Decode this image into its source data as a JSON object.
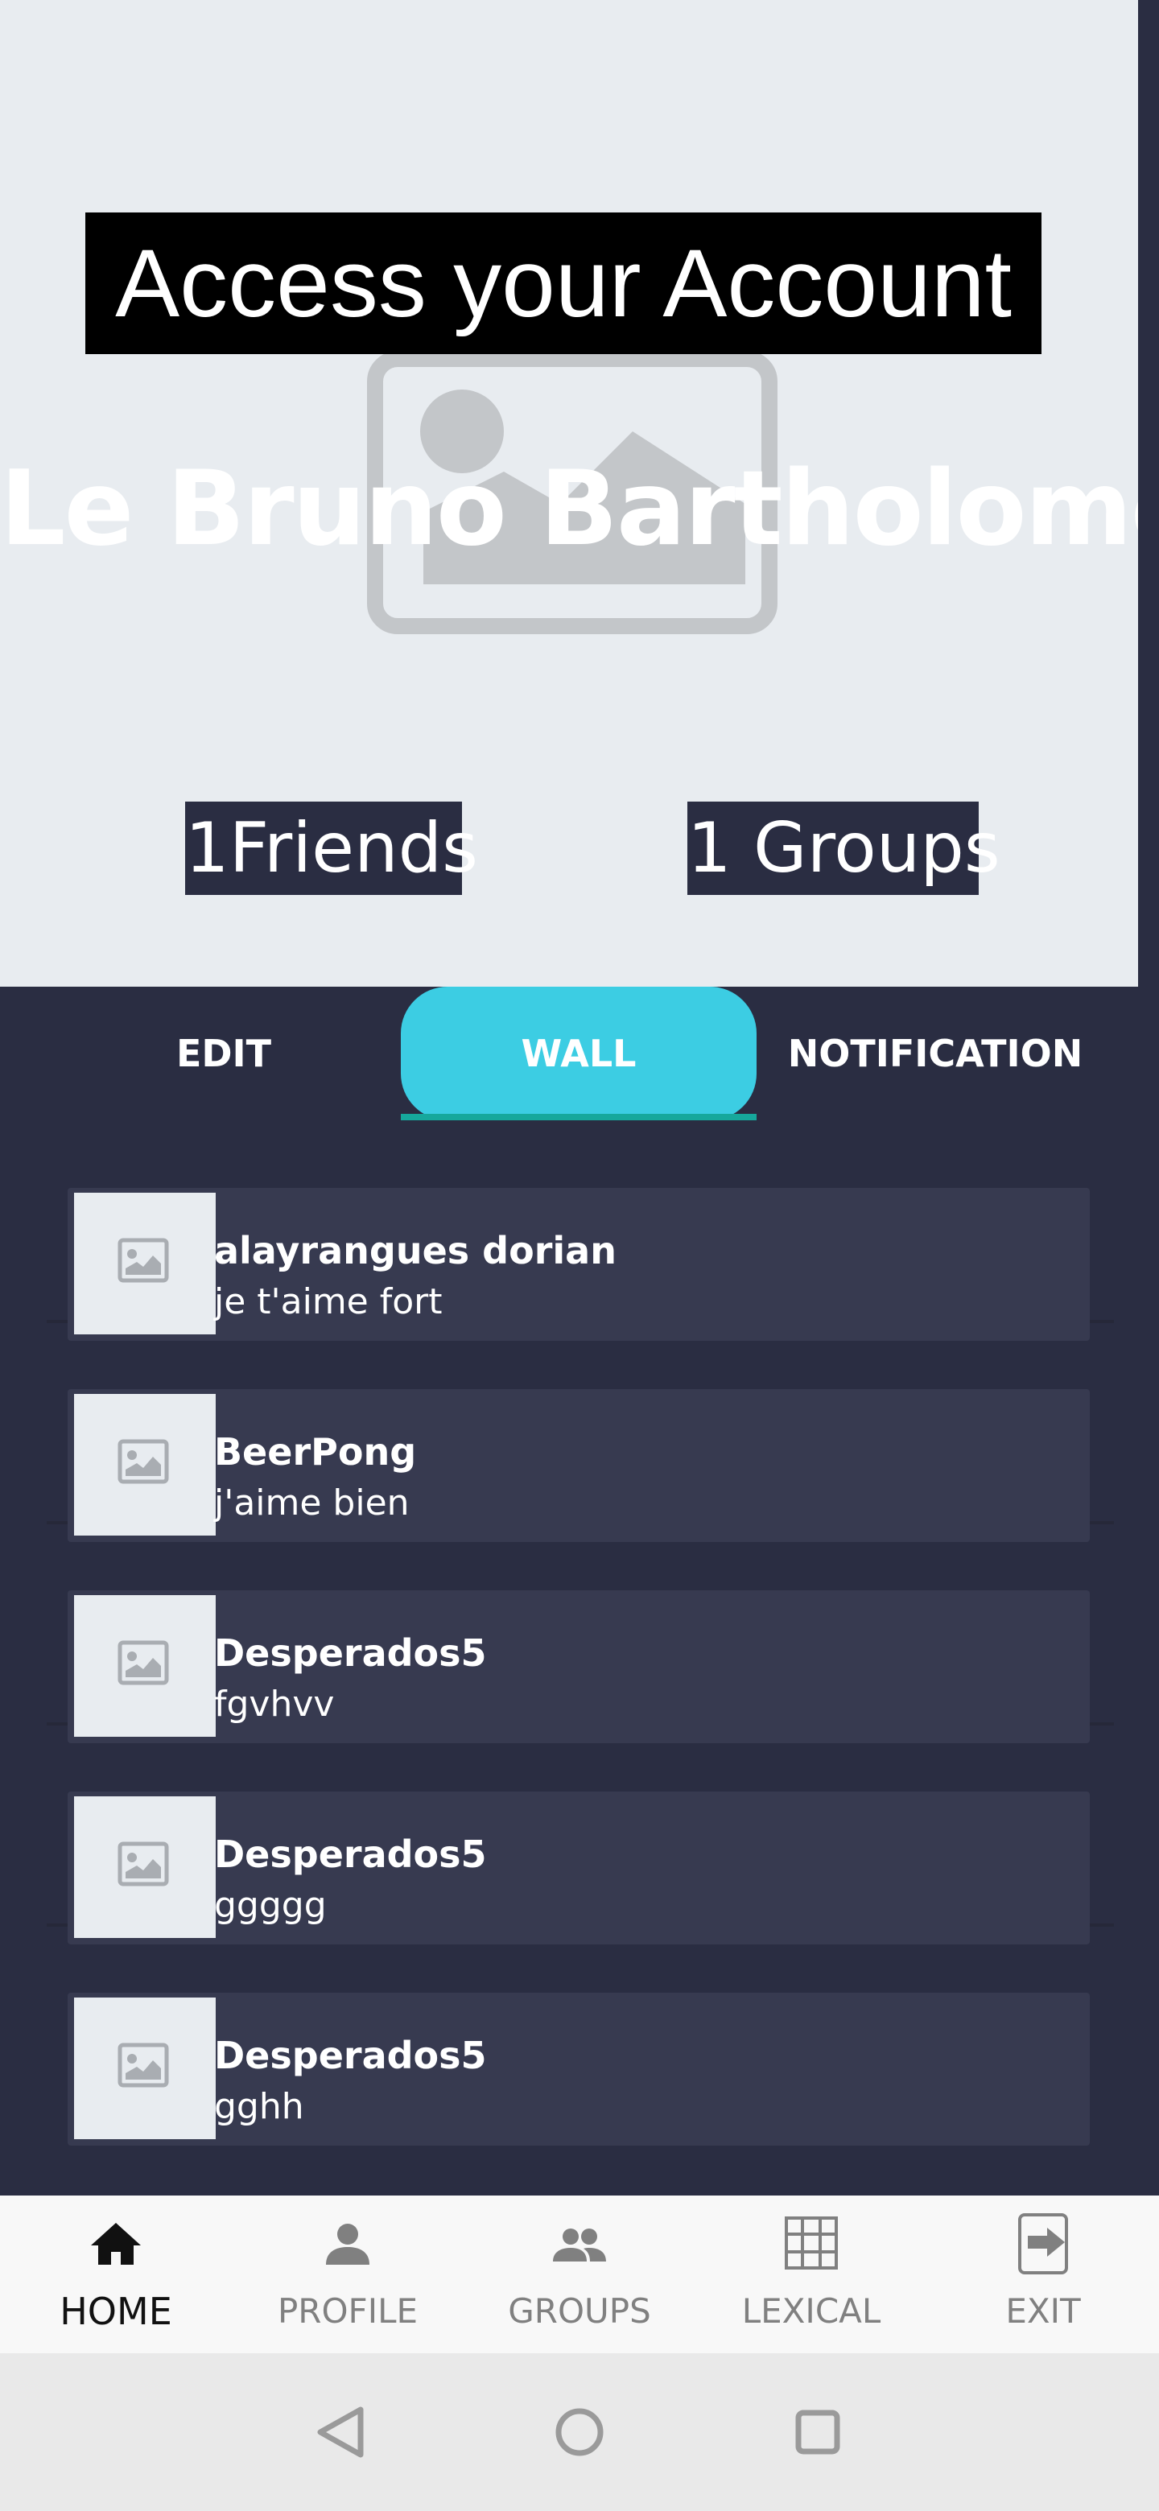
{
  "header": {
    "access_title": "Access your Account",
    "profile_name": "Le Bruno Bartholomé",
    "friends_count": "1Friends",
    "groups_count": "1 Groups"
  },
  "tabs": [
    {
      "label": "EDIT",
      "active": false
    },
    {
      "label": "WALL",
      "active": true
    },
    {
      "label": "NOTIFICATION",
      "active": false
    }
  ],
  "posts": [
    {
      "author": "alayrangues dorian",
      "message": "je t'aime fort"
    },
    {
      "author": "BeerPong",
      "message": "j'aime bien"
    },
    {
      "author": "Desperados5",
      "message": "fgvhvv"
    },
    {
      "author": "Desperados5",
      "message": "ggggg"
    },
    {
      "author": "Desperados5",
      "message": "gghh"
    }
  ],
  "bottom_nav": [
    {
      "label": "HOME",
      "icon": "home-icon",
      "active": true
    },
    {
      "label": "PROFILE",
      "icon": "person-icon",
      "active": false
    },
    {
      "label": "GROUPS",
      "icon": "groups-icon",
      "active": false
    },
    {
      "label": "LEXICAL",
      "icon": "grid-icon",
      "active": false
    },
    {
      "label": "EXIT",
      "icon": "exit-icon",
      "active": false
    }
  ],
  "system_nav": [
    "back-icon",
    "home-circle-icon",
    "recents-icon"
  ],
  "colors": {
    "header_bg": "#e8ecf0",
    "dark_bg": "#2a2d42",
    "card_bg": "#373a50",
    "tab_active": "#3ccde3",
    "tab_underline": "#16a89c"
  }
}
